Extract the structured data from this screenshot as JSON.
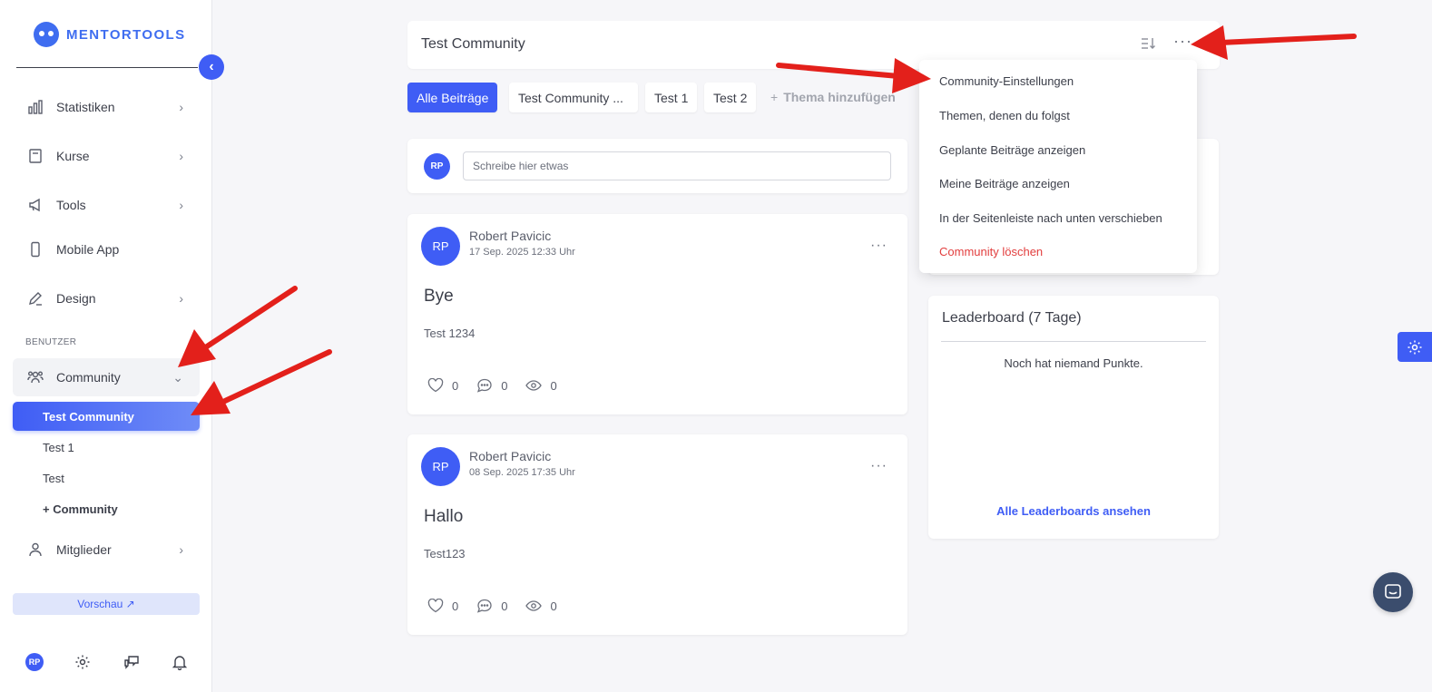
{
  "brand": {
    "name": "MENTORTOOLS"
  },
  "sidebar": {
    "items": [
      {
        "label": "Statistiken"
      },
      {
        "label": "Kurse"
      },
      {
        "label": "Tools"
      },
      {
        "label": "Mobile App"
      },
      {
        "label": "Design"
      }
    ],
    "section_label": "BENUTZER",
    "community": {
      "label": "Community"
    },
    "community_children": [
      {
        "label": "Test Community"
      },
      {
        "label": "Test 1"
      },
      {
        "label": "Test"
      },
      {
        "label": "+ Community"
      }
    ],
    "members": {
      "label": "Mitglieder"
    },
    "preview": {
      "label": "Vorschau ↗"
    },
    "user_initials": "RP"
  },
  "header": {
    "title": "Test Community"
  },
  "tabs": [
    {
      "label": "Alle Beiträge"
    },
    {
      "label": "Test Community ..."
    },
    {
      "label": "Test 1"
    },
    {
      "label": "Test 2"
    }
  ],
  "add_topic": {
    "label": "Thema hinzufügen"
  },
  "composer": {
    "initials": "RP",
    "placeholder": "Schreibe hier etwas"
  },
  "posts": [
    {
      "initials": "RP",
      "author": "Robert Pavicic",
      "date": "17 Sep. 2025 12:33 Uhr",
      "title": "Bye",
      "body": "Test 1234",
      "likes": "0",
      "comments": "0",
      "views": "0"
    },
    {
      "initials": "RP",
      "author": "Robert Pavicic",
      "date": "08 Sep. 2025 17:35 Uhr",
      "title": "Hallo",
      "body": "Test123",
      "likes": "0",
      "comments": "0",
      "views": "0"
    }
  ],
  "leaderboard": {
    "title": "Leaderboard (7 Tage)",
    "empty": "Noch hat niemand Punkte.",
    "link": "Alle Leaderboards ansehen"
  },
  "dropdown": {
    "items": [
      {
        "label": "Community-Einstellungen"
      },
      {
        "label": "Themen, denen du folgst"
      },
      {
        "label": "Geplante Beiträge anzeigen"
      },
      {
        "label": "Meine Beiträge anzeigen"
      },
      {
        "label": "In der Seitenleiste nach unten verschieben"
      }
    ],
    "danger": {
      "label": "Community löschen"
    }
  },
  "colors": {
    "accent": "#3f5df5",
    "danger": "#e23e3e",
    "annotation_arrow": "#e3201b"
  }
}
